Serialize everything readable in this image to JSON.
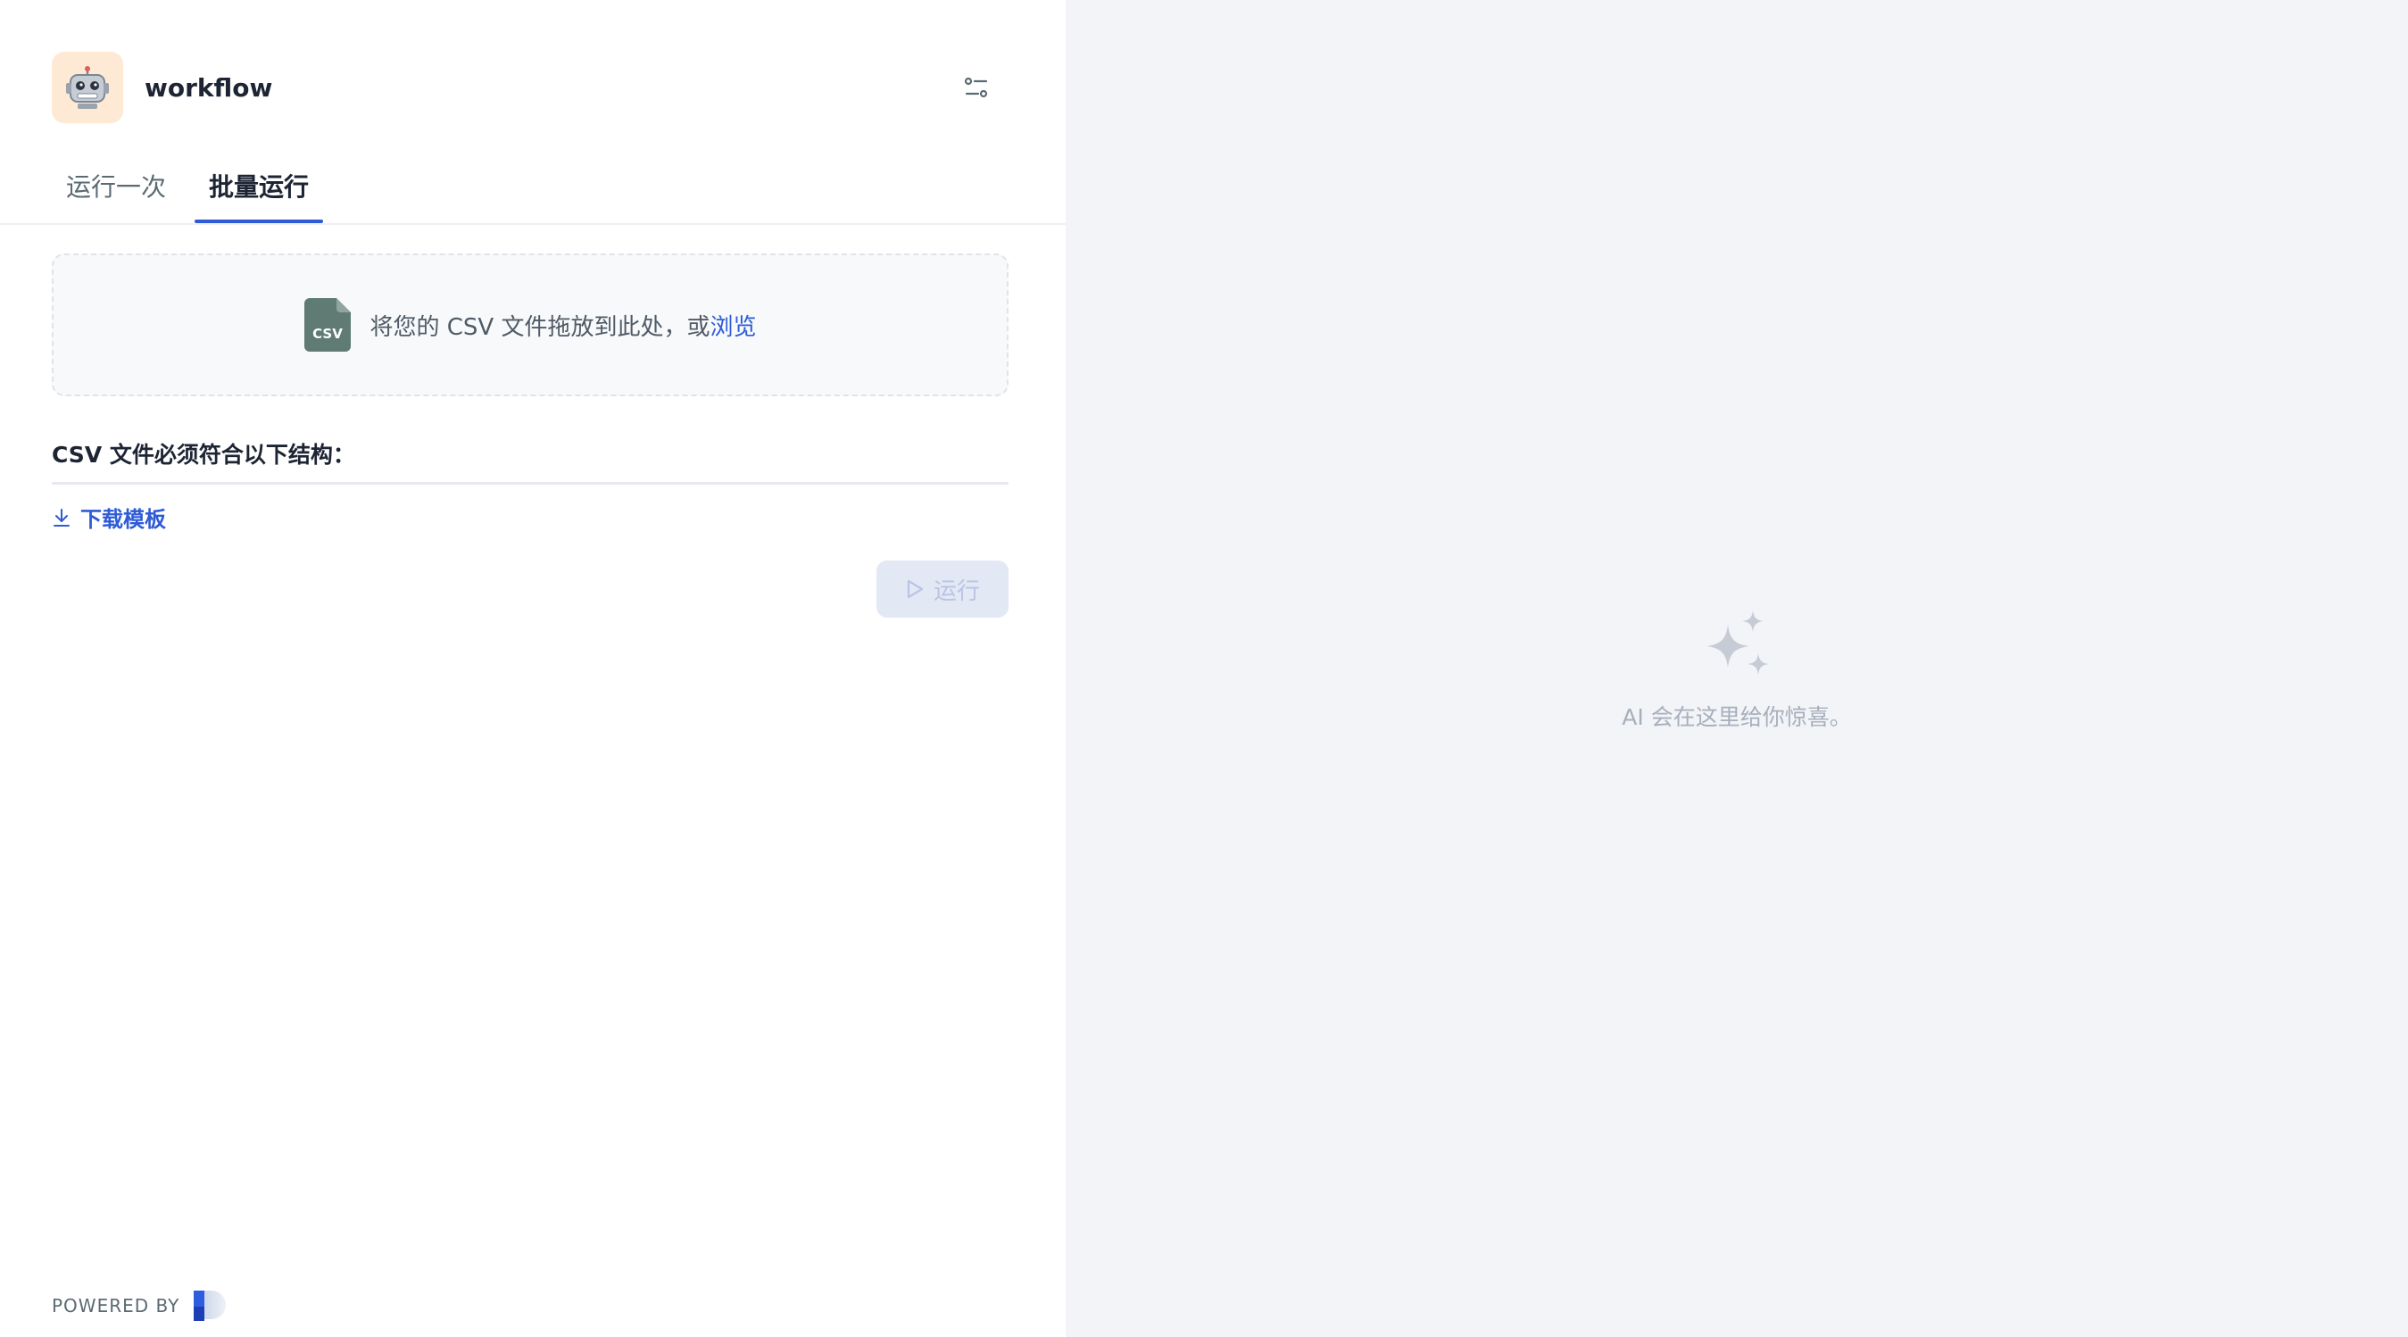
{
  "app": {
    "title": "workflow",
    "avatar": "robot-emoji"
  },
  "tabs": [
    {
      "label": "运行一次",
      "active": false
    },
    {
      "label": "批量运行",
      "active": true
    }
  ],
  "upload": {
    "icon": "csv-file-icon",
    "prompt": "将您的 CSV 文件拖放到此处，或",
    "browse_label": "浏览"
  },
  "structure": {
    "title": "CSV 文件必须符合以下结构：",
    "download_label": "下载模板"
  },
  "run_button": {
    "label": "运行",
    "disabled": true
  },
  "footer": {
    "powered_by": "POWERED BY"
  },
  "empty_state": {
    "message": "AI 会在这里给你惊喜。"
  },
  "colors": {
    "accent": "#2e5bd6",
    "right_bg": "#f3f4f7",
    "avatar_bg": "#fde9d4",
    "csv_icon": "#5f7b73"
  }
}
